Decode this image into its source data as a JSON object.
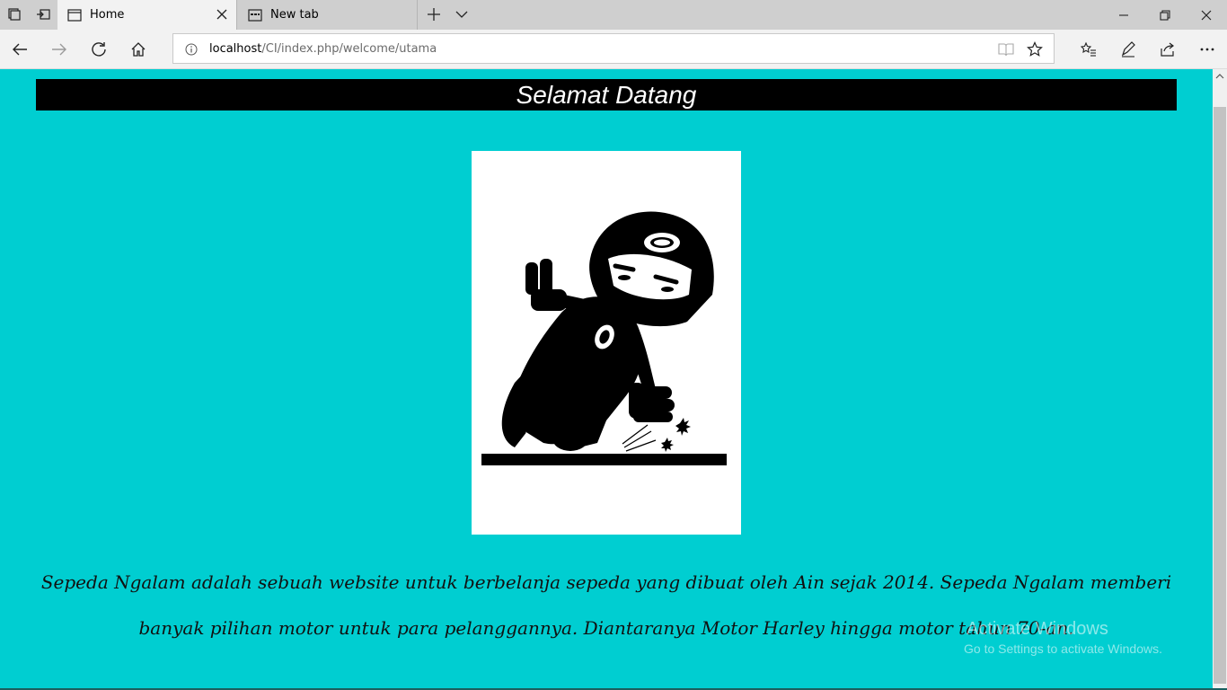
{
  "browser": {
    "tabs": [
      {
        "label": "Home",
        "icon": "page-icon",
        "active": true
      },
      {
        "label": "New tab",
        "icon": "newtab-page-icon",
        "active": false
      }
    ],
    "url": {
      "host": "localhost",
      "path": "/CI/index.php/welcome/utama"
    }
  },
  "page": {
    "header_title": "Selamat Datang",
    "image_subject": "motorcycle-rider-cornering",
    "description": "Sepeda Ngalam adalah sebuah website untuk berbelanja sepeda yang dibuat oleh Ain sejak 2014. Sepeda Ngalam memberi banyak pilihan motor untuk para pelanggannya. Diantaranya Motor Harley hingga motor tahun 70-an."
  },
  "watermark": {
    "line1": "Activate Windows",
    "line2": "Go to Settings to activate Windows."
  },
  "colors": {
    "page_background": "#00ced1",
    "header_background": "#000000",
    "header_text": "#ffffff"
  }
}
